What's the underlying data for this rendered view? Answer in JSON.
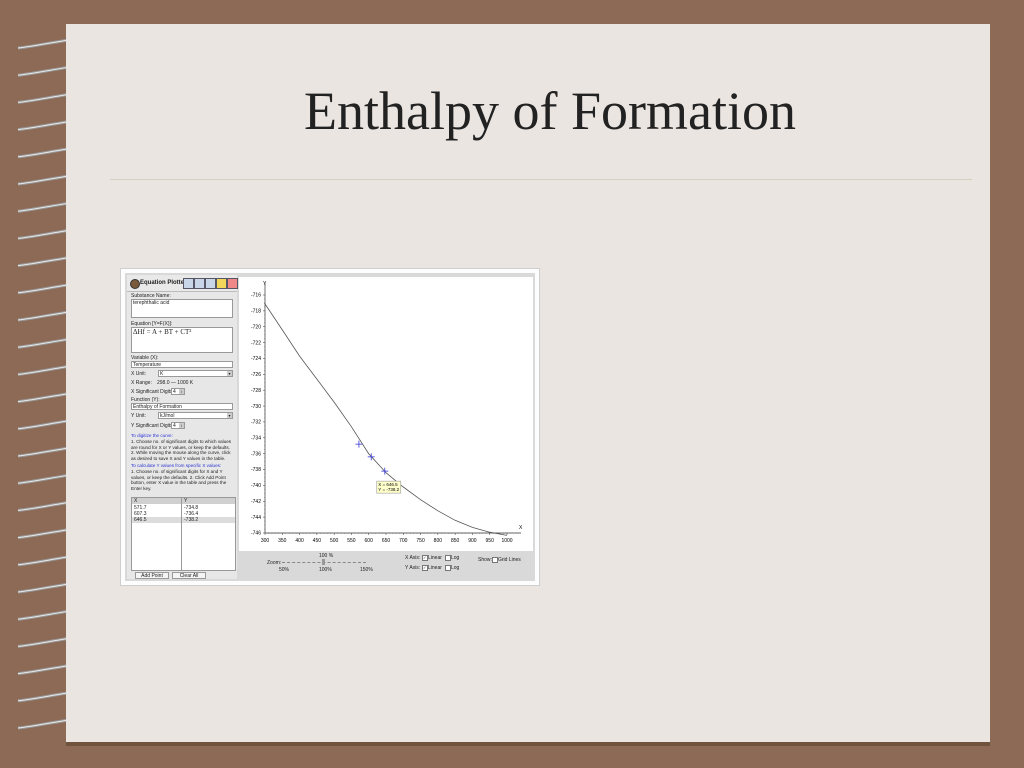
{
  "slide": {
    "title": "Enthalpy of Formation"
  },
  "colors": {
    "background": "#8c6a55",
    "paper": "#ebe5e1",
    "title_text": "#222222",
    "curve": "#555555",
    "marker": "#3a3ad8",
    "tooltip_bg": "#ffffcc"
  },
  "app": {
    "name": "Equation Plotter",
    "toolbar_icons": [
      "minus-icon",
      "duplicate-icon",
      "save-icon",
      "folder-icon",
      "print-icon"
    ],
    "substance_label": "Substance Name:",
    "substance_value": "terephthalic acid",
    "equation_label": "Equation [Y=F(X)]:",
    "equation_value": "ΔHf = A + BT + CT²",
    "variable_label": "Variable (X):",
    "variable_value": "Temperature",
    "x_unit_label": "X Unit:",
    "x_unit_value": "K",
    "x_range_label": "X Range:",
    "x_range_value": "298.0 — 1000 K",
    "x_sig_label": "X Significant Digits:",
    "x_sig_value": "4",
    "function_label": "Function (Y):",
    "function_value": "Enthalpy of Formation",
    "y_unit_label": "Y Unit:",
    "y_unit_value": "kJ/mol",
    "y_sig_label": "Y Significant Digits:",
    "y_sig_value": "4",
    "digitize_heading": "To digitize the curve:",
    "digitize_text": "1. Choose no. of significant digits to which values are round for X or Y values, or keep the defaults. 2. While moving the mouse along the curve, click as desired to save X and Y values in the table.",
    "calc_heading": "To calculate Y values from specific X values:",
    "calc_text": "1. Choose no. of significant digits for X and Y values, or keep the defaults. 2. Click Add Point button, enter X value in the table and press the Enter key.",
    "table_headers": [
      "X",
      "Y"
    ],
    "table_rows": [
      [
        "571.7",
        "-734.8"
      ],
      [
        "607.3",
        "-736.4"
      ],
      [
        "646.5",
        "-738.2"
      ]
    ],
    "add_point_label": "Add Point",
    "clear_all_label": "Clear All"
  },
  "plot_controls": {
    "zoom_label": "Zoom:",
    "zoom_value": "100 %",
    "zoom_min": "50%",
    "zoom_mid": "100%",
    "zoom_max": "150%",
    "x_axis_label": "X Axis:",
    "y_axis_label": "Y Axis:",
    "linear_label": "Linear",
    "log_label": "Log",
    "show_label": "Show:",
    "grid_lines_label": "Grid Lines"
  },
  "chart_data": {
    "type": "line",
    "title": "",
    "xlabel": "X",
    "ylabel": "Y",
    "xlim": [
      300,
      1000
    ],
    "ylim": [
      -746,
      -716
    ],
    "x_ticks": [
      300,
      350,
      400,
      450,
      500,
      550,
      600,
      650,
      700,
      750,
      800,
      850,
      900,
      950,
      1000
    ],
    "y_ticks": [
      -716,
      -718,
      -720,
      -722,
      -724,
      -726,
      -728,
      -730,
      -732,
      -734,
      -736,
      -738,
      -740,
      -742,
      -744,
      -746
    ],
    "grid": false,
    "legend": "none",
    "series": [
      {
        "x": [
          298,
          350,
          400,
          450,
          500,
          550,
          600,
          650,
          700,
          750,
          800,
          850,
          900,
          950,
          1000
        ],
        "y": [
          -717.0,
          -720.4,
          -723.7,
          -726.6,
          -729.5,
          -732.6,
          -736.0,
          -738.4,
          -740.2,
          -741.8,
          -743.2,
          -744.4,
          -745.3,
          -745.9,
          -746.3
        ]
      }
    ],
    "markers": [
      {
        "x": 571.7,
        "y": -734.8
      },
      {
        "x": 607.3,
        "y": -736.4
      },
      {
        "x": 646.5,
        "y": -738.2
      }
    ],
    "tooltip": {
      "line1": "X = 646.5",
      "line2": "Y = -738.2",
      "x": 646.5,
      "y": -738.2
    }
  }
}
